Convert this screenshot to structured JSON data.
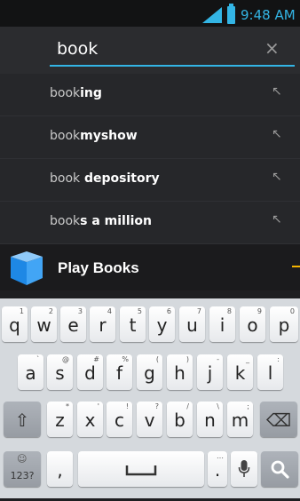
{
  "status_bar": {
    "time": "9:48 AM"
  },
  "search": {
    "query": "book",
    "clear_glyph": "×"
  },
  "suggestions": [
    {
      "prefix": "book",
      "completion": "ing"
    },
    {
      "prefix": "book",
      "completion": "myshow"
    },
    {
      "prefix": "book",
      "completion": " depository"
    },
    {
      "prefix": "book",
      "completion": "s a million"
    }
  ],
  "suggestion_arrow_glyph": "↖",
  "app_result": {
    "label": "Play Books",
    "icon": "play-books-icon"
  },
  "keyboard": {
    "row1": [
      {
        "label": "q",
        "sub": "1"
      },
      {
        "label": "w",
        "sub": "2"
      },
      {
        "label": "e",
        "sub": "3"
      },
      {
        "label": "r",
        "sub": "4"
      },
      {
        "label": "t",
        "sub": "5"
      },
      {
        "label": "y",
        "sub": "6"
      },
      {
        "label": "u",
        "sub": "7"
      },
      {
        "label": "i",
        "sub": "8"
      },
      {
        "label": "o",
        "sub": "9"
      },
      {
        "label": "p",
        "sub": "0"
      }
    ],
    "row2": [
      {
        "label": "a",
        "sub": "`"
      },
      {
        "label": "s",
        "sub": "@"
      },
      {
        "label": "d",
        "sub": "#"
      },
      {
        "label": "f",
        "sub": "%"
      },
      {
        "label": "g",
        "sub": "("
      },
      {
        "label": "h",
        "sub": ")"
      },
      {
        "label": "j",
        "sub": "-"
      },
      {
        "label": "k",
        "sub": "_"
      },
      {
        "label": "l",
        "sub": ":"
      }
    ],
    "row3": [
      {
        "label": "z",
        "sub": "*"
      },
      {
        "label": "x",
        "sub": "'"
      },
      {
        "label": "c",
        "sub": "!"
      },
      {
        "label": "v",
        "sub": "?"
      },
      {
        "label": "b",
        "sub": "/"
      },
      {
        "label": "n",
        "sub": "\\"
      },
      {
        "label": "m",
        "sub": ";"
      }
    ],
    "shift_glyph": "⇧",
    "backspace_glyph": "⌫",
    "symbols_label": "123?",
    "symbols_sub": "☺",
    "comma_label": ",",
    "space_glyph": "␣",
    "period_label": ".",
    "period_sub": "…",
    "mic_icon": "microphone-icon",
    "search_icon": "search-icon"
  },
  "colors": {
    "accent": "#33b5e5",
    "marker": "#f5b400"
  }
}
